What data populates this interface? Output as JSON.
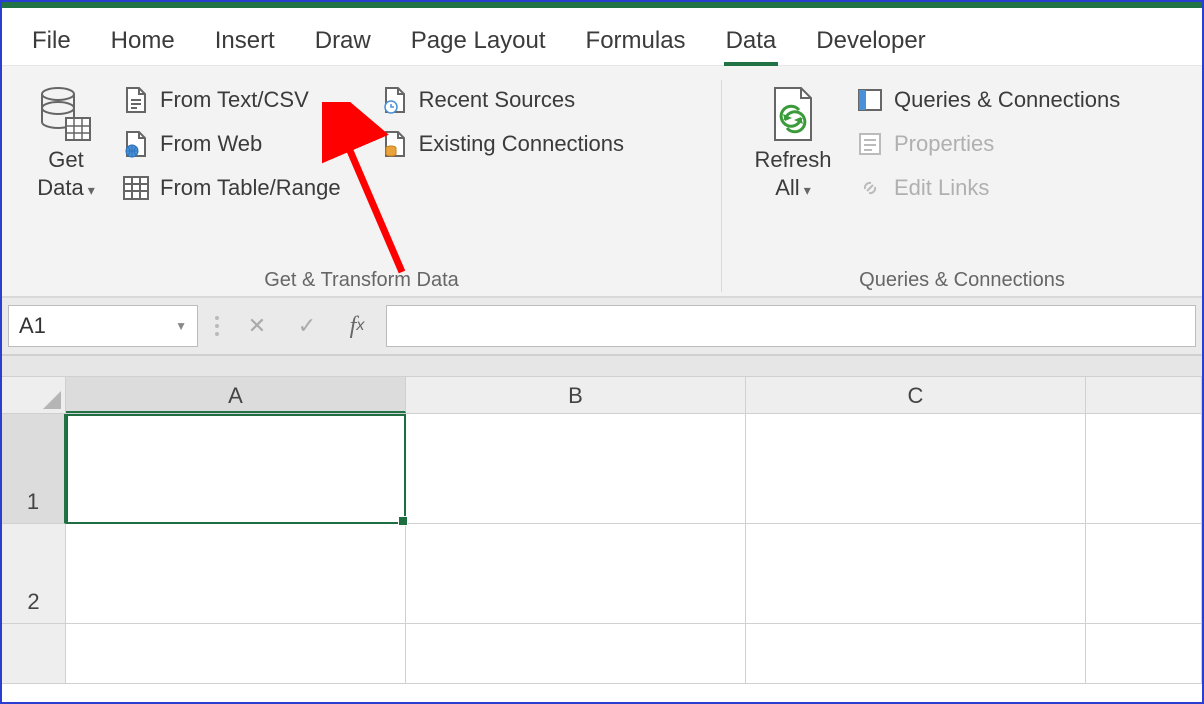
{
  "tabs": {
    "file": "File",
    "home": "Home",
    "insert": "Insert",
    "draw": "Draw",
    "pagelayout": "Page Layout",
    "formulas": "Formulas",
    "data": "Data",
    "developer": "Developer",
    "active": "data"
  },
  "ribbon_groups": {
    "get_transform": {
      "label": "Get & Transform Data",
      "get_data": "Get\nData",
      "from_text_csv": "From Text/CSV",
      "from_web": "From Web",
      "from_table_range": "From Table/Range",
      "recent_sources": "Recent Sources",
      "existing_connections": "Existing Connections"
    },
    "queries_connections": {
      "label": "Queries & Connections",
      "refresh_all": "Refresh\nAll",
      "queries_connections": "Queries & Connections",
      "properties": "Properties",
      "edit_links": "Edit Links"
    }
  },
  "formula_bar": {
    "name_box_value": "A1",
    "formula_value": ""
  },
  "columns": [
    "A",
    "B",
    "C"
  ],
  "rows": [
    "1",
    "2"
  ],
  "selected_cell": "A1",
  "annotation": {
    "arrow_target": "from_text_csv",
    "arrow_color": "#ff0000"
  }
}
